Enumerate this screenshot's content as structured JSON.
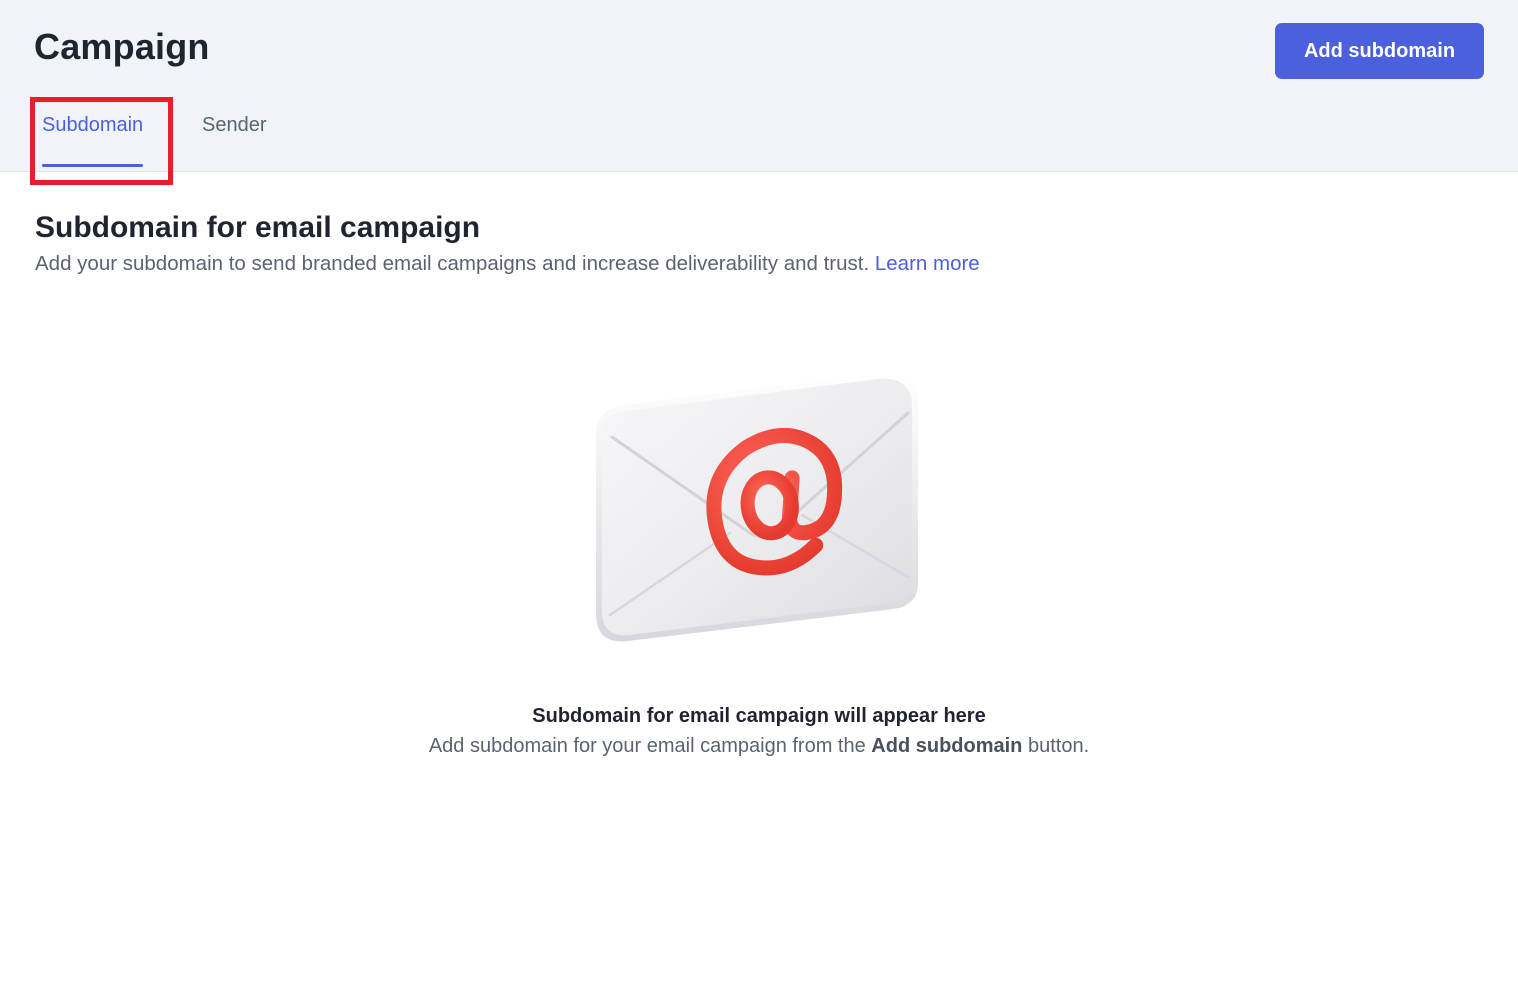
{
  "header": {
    "title": "Campaign",
    "add_button_label": "Add subdomain",
    "tabs": [
      {
        "label": "Subdomain",
        "active": true
      },
      {
        "label": "Sender",
        "active": false
      }
    ]
  },
  "section": {
    "title": "Subdomain for email campaign",
    "description": "Add your subdomain to send branded email campaigns and increase deliverability and trust.",
    "link_label": "Learn more"
  },
  "empty_state": {
    "illustration_icon": "envelope-at-icon",
    "title": "Subdomain for email campaign will appear here",
    "desc_prefix": "Add subdomain for your email campaign from the",
    "desc_bold": "Add subdomain",
    "desc_suffix": "button."
  },
  "colors": {
    "accent": "#4c5fdc",
    "highlight": "#e81f2a",
    "header_bg": "#f0f3f8",
    "at_symbol": "#ee4438"
  }
}
